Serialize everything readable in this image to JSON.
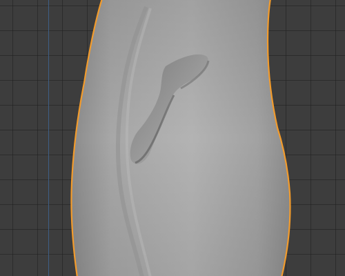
{
  "viewport": {
    "background_color": "#3d3d3d",
    "grid_line_color": "#2f2f2f",
    "y_axis_color": "#3f5f86"
  },
  "selected_object": {
    "kind": "sculpted-mesh",
    "selection_outline_color": "#f29b2c",
    "surface_color": "#a8a8a8",
    "is_selected": true
  }
}
